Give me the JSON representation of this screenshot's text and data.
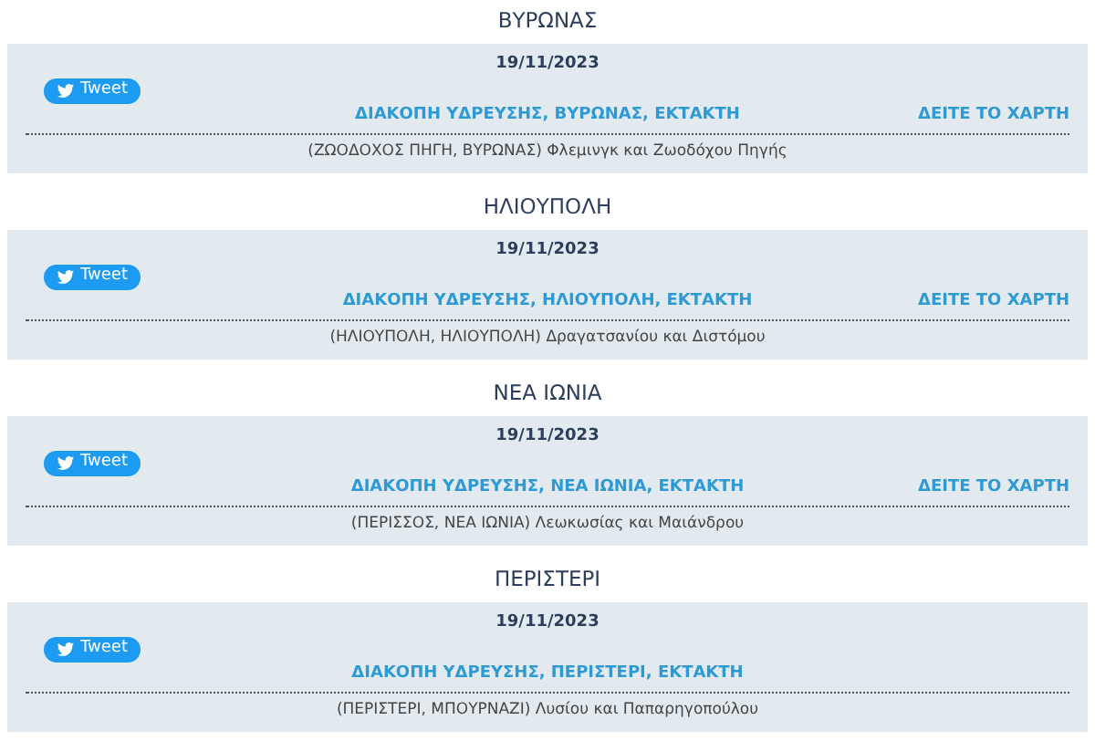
{
  "sections": [
    {
      "area": "ΒΥΡΩΝΑΣ",
      "date": "19/11/2023",
      "tweet": "Tweet",
      "title": "ΔΙΑΚΟΠΗ ΥΔΡΕΥΣΗΣ, ΒΥΡΩΝΑΣ, ΕΚΤΑΚΤΗ",
      "map_link": "ΔΕΙΤΕ ΤΟ ΧΑΡΤΗ",
      "address": "(ΖΩΟΔΟΧΟΣ ΠΗΓΗ, ΒΥΡΩΝΑΣ) Φλεμινγκ και Ζωοδόχου Πηγής"
    },
    {
      "area": "ΗΛΙΟΥΠΟΛΗ",
      "date": "19/11/2023",
      "tweet": "Tweet",
      "title": "ΔΙΑΚΟΠΗ ΥΔΡΕΥΣΗΣ, ΗΛΙΟΥΠΟΛΗ, ΕΚΤΑΚΤΗ",
      "map_link": "ΔΕΙΤΕ ΤΟ ΧΑΡΤΗ",
      "address": "(ΗΛΙΟΥΠΟΛΗ, ΗΛΙΟΥΠΟΛΗ) Δραγατσανίου και Διστόμου"
    },
    {
      "area": "ΝΕΑ ΙΩΝΙΑ",
      "date": "19/11/2023",
      "tweet": "Tweet",
      "title": "ΔΙΑΚΟΠΗ ΥΔΡΕΥΣΗΣ, ΝΕΑ ΙΩΝΙΑ, ΕΚΤΑΚΤΗ",
      "map_link": "ΔΕΙΤΕ ΤΟ ΧΑΡΤΗ",
      "address": "(ΠΕΡΙΣΣΟΣ, ΝΕΑ ΙΩΝΙΑ) Λεωκωσίας και Μαιάνδρου"
    },
    {
      "area": "ΠΕΡΙΣΤΕΡΙ",
      "date": "19/11/2023",
      "tweet": "Tweet",
      "title": "ΔΙΑΚΟΠΗ ΥΔΡΕΥΣΗΣ, ΠΕΡΙΣΤΕΡΙ, ΕΚΤΑΚΤΗ",
      "address": "(ΠΕΡΙΣΤΕΡΙ, ΜΠΟΥΡΝΑΖΙ) Λυσίου και Παπαρηγοπούλου"
    }
  ]
}
